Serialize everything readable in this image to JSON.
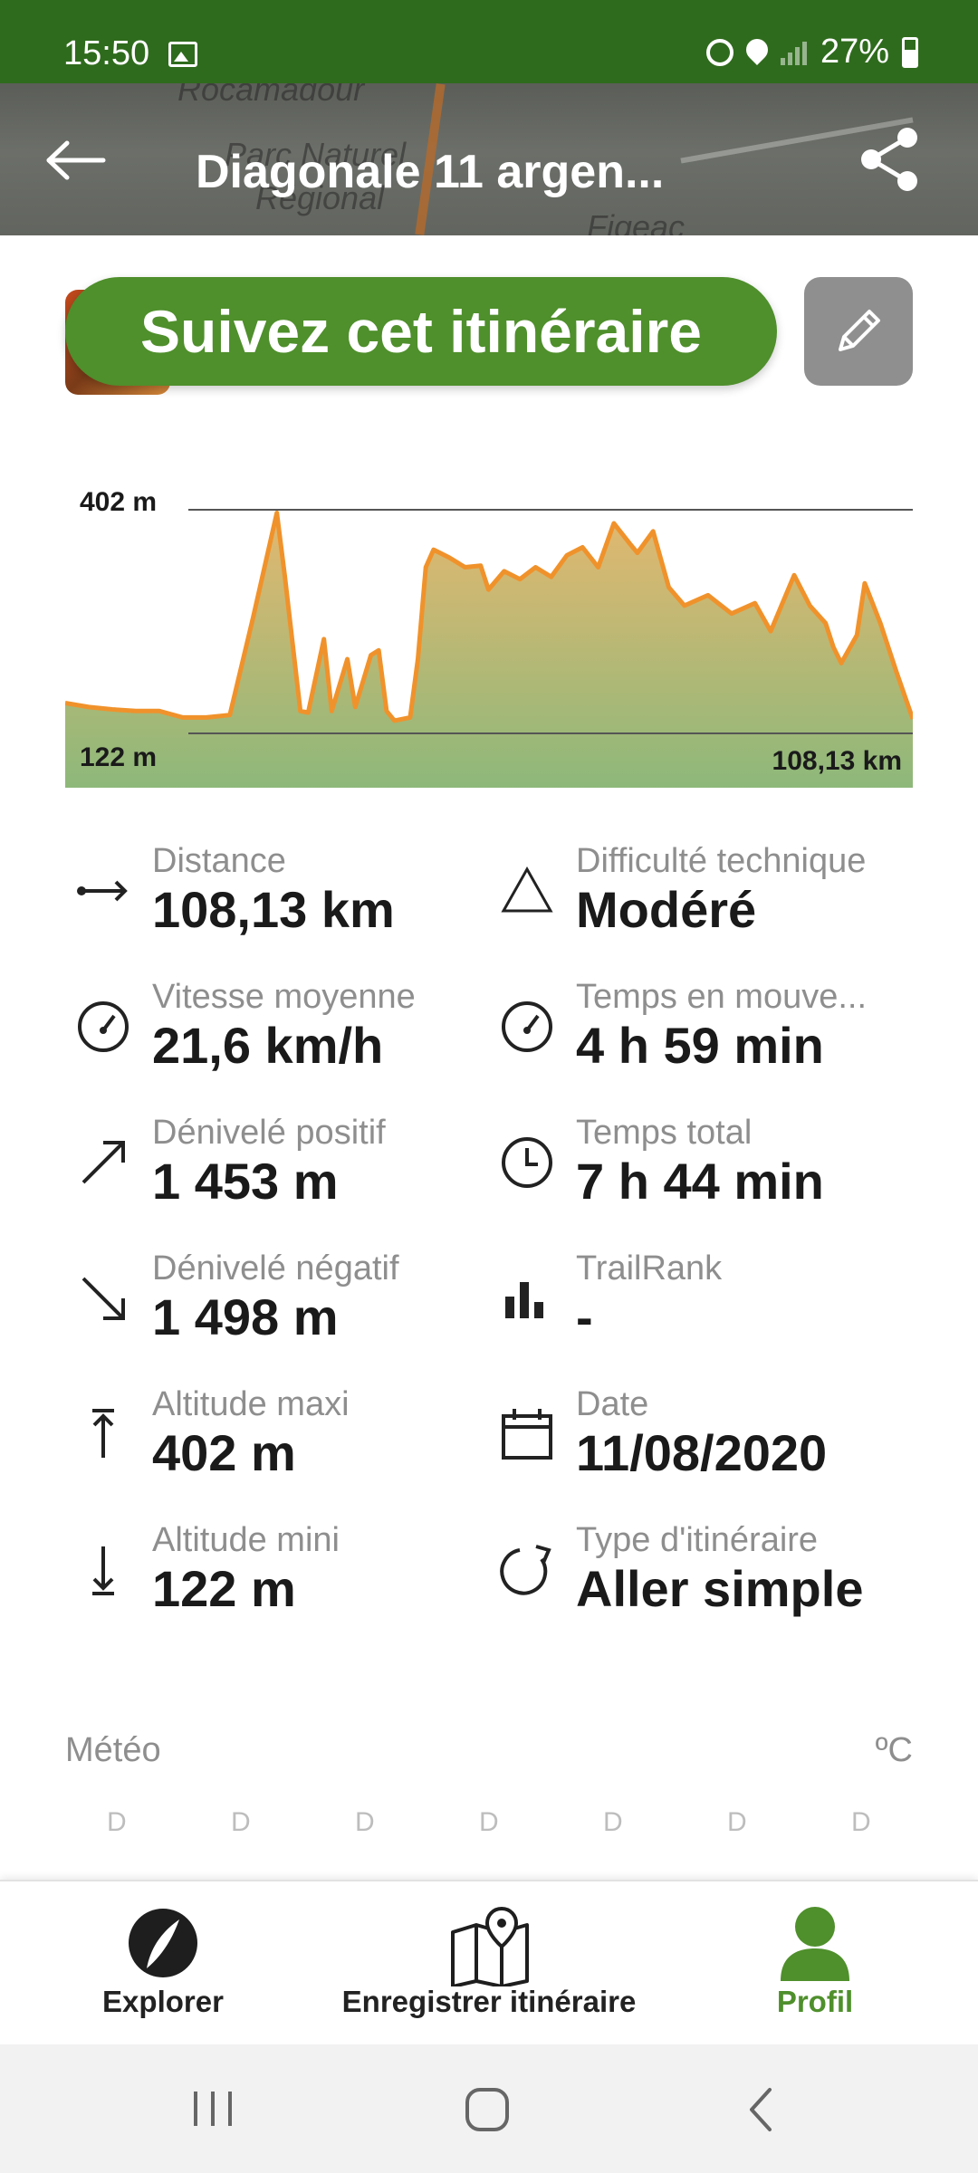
{
  "status_bar": {
    "time": "15:50",
    "battery": "27%"
  },
  "header": {
    "title": "Diagonale 11 argen...",
    "map_labels": [
      "Rocamadour",
      "Parc Naturel",
      "Régional",
      "Figeac"
    ]
  },
  "actions": {
    "follow_label": "Suivez cet itinéraire"
  },
  "elevation": {
    "max_label": "402 m",
    "min_label": "122 m",
    "distance_label": "108,13 km"
  },
  "chart_data": {
    "type": "area",
    "x": [
      0,
      3,
      6,
      9,
      12,
      15,
      18,
      21,
      24,
      27,
      28,
      30,
      31,
      33,
      34,
      36,
      37,
      39,
      40,
      41,
      42,
      44,
      45,
      46,
      47,
      49,
      51,
      53,
      54,
      56,
      58,
      60,
      62,
      64,
      66,
      68,
      70,
      72,
      73,
      75,
      77,
      79,
      82,
      85,
      88,
      90,
      93,
      95,
      97,
      98,
      99,
      101,
      102,
      104,
      106,
      108.13
    ],
    "values": [
      160,
      155,
      152,
      150,
      150,
      142,
      142,
      145,
      268,
      398,
      320,
      150,
      148,
      240,
      150,
      215,
      155,
      220,
      226,
      150,
      138,
      142,
      215,
      330,
      352,
      342,
      330,
      332,
      302,
      325,
      315,
      330,
      318,
      345,
      355,
      330,
      385,
      360,
      348,
      375,
      305,
      282,
      295,
      272,
      285,
      250,
      320,
      282,
      260,
      230,
      210,
      245,
      310,
      260,
      200,
      140
    ],
    "xlim": [
      0,
      108.13
    ],
    "ylim": [
      122,
      402
    ],
    "grid": true,
    "line_color": "#f0922b",
    "fill_top_color": "#e3b870",
    "fill_bottom_color": "#8db87a"
  },
  "stats": {
    "distance": {
      "label": "Distance",
      "value": "108,13 km"
    },
    "difficulty": {
      "label": "Difficulté technique",
      "value": "Modéré"
    },
    "avg_speed": {
      "label": "Vitesse moyenne",
      "value": "21,6 km/h"
    },
    "moving_time": {
      "label": "Temps en mouve...",
      "value": "4 h 59 min"
    },
    "elev_gain": {
      "label": "Dénivelé positif",
      "value": "1 453 m"
    },
    "total_time": {
      "label": "Temps total",
      "value": "7 h 44 min"
    },
    "elev_loss": {
      "label": "Dénivelé négatif",
      "value": "1 498 m"
    },
    "trailrank": {
      "label": "TrailRank",
      "value": "-"
    },
    "alt_max": {
      "label": "Altitude maxi",
      "value": "402 m"
    },
    "date": {
      "label": "Date",
      "value": "11/08/2020"
    },
    "alt_min": {
      "label": "Altitude mini",
      "value": "122 m"
    },
    "trail_type": {
      "label": "Type d'itinéraire",
      "value": "Aller simple"
    }
  },
  "weather": {
    "label": "Météo",
    "unit": "ºC",
    "days": [
      "D",
      "D",
      "D",
      "D",
      "D",
      "D",
      "D"
    ]
  },
  "bottom_nav": {
    "explore": "Explorer",
    "record": "Enregistrer itinéraire",
    "profile": "Profil",
    "active_color": "#4f8f2c"
  }
}
